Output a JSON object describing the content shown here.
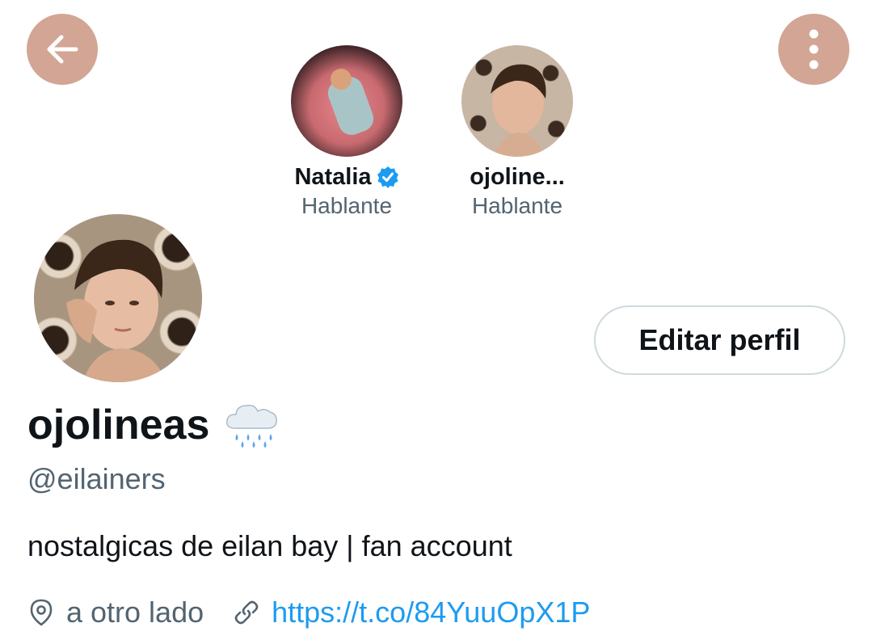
{
  "header": {
    "back_icon": "arrow-left-icon",
    "more_icon": "more-vertical-icon",
    "button_color": "#d2a594"
  },
  "speakers": [
    {
      "name": "Natalia",
      "verified": true,
      "role": "Hablante"
    },
    {
      "name": "ojoline...",
      "verified": false,
      "role": "Hablante"
    }
  ],
  "profile": {
    "display_name": "ojolineas",
    "name_emoji": "rain-cloud-icon",
    "handle": "@eilainers",
    "edit_label": "Editar perfil",
    "bio": "nostalgicas de eilan bay | fan account",
    "location": "a otro lado",
    "url": "https://t.co/84YuuOpX1P"
  },
  "colors": {
    "accent": "#1d9bf0",
    "secondary_text": "#536471"
  }
}
